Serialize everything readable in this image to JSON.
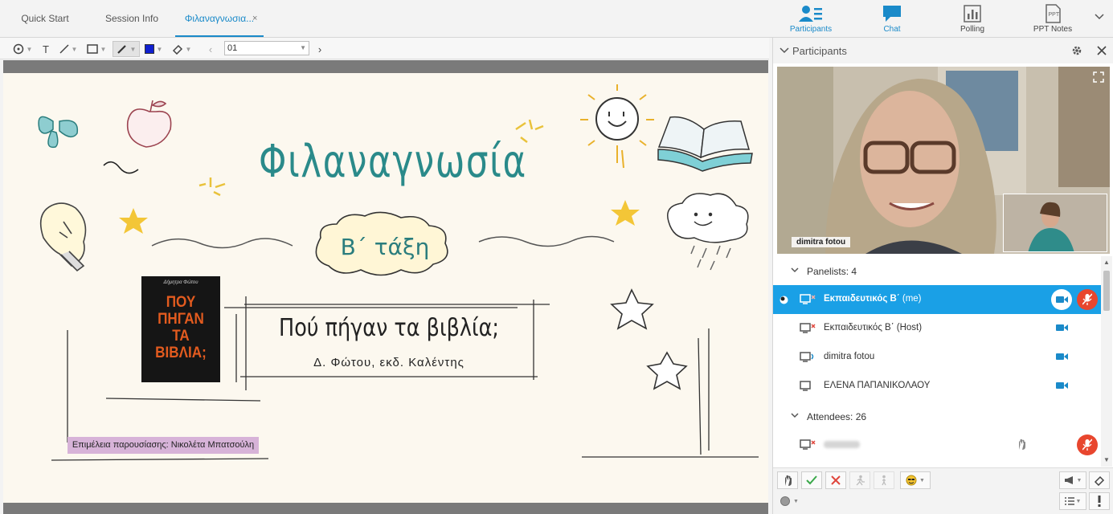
{
  "tabs": [
    {
      "label": "Quick Start"
    },
    {
      "label": "Session Info"
    },
    {
      "label": "Φιλαναγνωσια..."
    }
  ],
  "tab_close": "×",
  "panel_buttons": [
    {
      "label": "Participants",
      "icon": "participants-icon"
    },
    {
      "label": "Chat",
      "icon": "chat-icon"
    },
    {
      "label": "Polling",
      "icon": "polling-icon"
    },
    {
      "label": "PPT Notes",
      "icon": "ppt-notes-icon"
    }
  ],
  "toolbar": {
    "page_value": "01",
    "prev": "‹",
    "next": "›",
    "text_tool": "T"
  },
  "slide": {
    "title": "Φιλαναγνωσία",
    "grade": "Β΄ τάξη",
    "book_title": "Πού πήγαν τα βιβλία;",
    "book_subtitle": "Δ. Φώτου, εκδ. Καλέντης",
    "credit": "Επιμέλεια παρουσίασης: Νικολέτα Μπατσούλη",
    "cover_title": "ΠΟΥ ΠΗΓΑΝ ΤΑ ΒΙΒΛΙΑ;",
    "cover_author": "Δήμητρα Φώτου"
  },
  "participants_panel": {
    "title": "Participants",
    "video_name": "dimitra fotou",
    "panelists_label": "Panelists: 4",
    "attendees_label": "Attendees: 26",
    "panelists": [
      {
        "name": "Εκπαιδευτικός Β΄",
        "suffix": "(me)"
      },
      {
        "name": "Εκπαιδευτικός Β΄ (Host)",
        "suffix": ""
      },
      {
        "name": "dimitra fotou",
        "suffix": ""
      },
      {
        "name": "ΕΛΕΝΑ ΠΑΠΑΝΙΚΟΛΑΟΥ",
        "suffix": ""
      }
    ]
  },
  "colors": {
    "accent": "#1a8ac9",
    "selected_row": "#1aa0e6",
    "mute_red": "#e8462e",
    "title_teal": "#2a8a8a"
  }
}
